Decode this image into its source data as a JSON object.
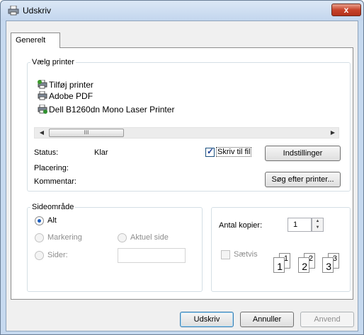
{
  "window": {
    "title": "Udskriv",
    "close_glyph": "x"
  },
  "tabs": [
    {
      "label": "Generelt"
    }
  ],
  "select_printer": {
    "legend": "Vælg printer",
    "printers": [
      {
        "label": "Tilføj printer",
        "icon": "add-printer-icon"
      },
      {
        "label": "Adobe PDF",
        "icon": "printer-icon"
      },
      {
        "label": "Dell B1260dn Mono Laser Printer",
        "icon": "default-printer-icon"
      }
    ],
    "scroll_left": "◀",
    "scroll_right": "▶",
    "scroll_grip": "III"
  },
  "status": {
    "status_label": "Status:",
    "status_value": "Klar",
    "location_label": "Placering:",
    "comment_label": "Kommentar:",
    "print_to_file_label": "Skriv til fil",
    "print_to_file_checked": true,
    "preferences_button": "Indstillinger",
    "find_printer_button": "Søg efter printer..."
  },
  "page_range": {
    "legend": "Sideområde",
    "all_label": "Alt",
    "selection_label": "Markering",
    "current_page_label": "Aktuel side",
    "pages_label": "Sider:",
    "pages_value": ""
  },
  "copies": {
    "number_label": "Antal kopier:",
    "number_value": "1",
    "spin_up": "▲",
    "spin_down": "▼",
    "collate_label": "Sætvis",
    "collate_checked": false,
    "collate_pages": [
      {
        "front": "1",
        "back": "1"
      },
      {
        "front": "2",
        "back": "2"
      },
      {
        "front": "3",
        "back": "3"
      }
    ]
  },
  "footer": {
    "print_button": "Udskriv",
    "cancel_button": "Annuller",
    "apply_button": "Anvend"
  },
  "colors": {
    "titlebar": "#c3d6ee",
    "close": "#c7422a",
    "accent": "#1c3f94"
  }
}
